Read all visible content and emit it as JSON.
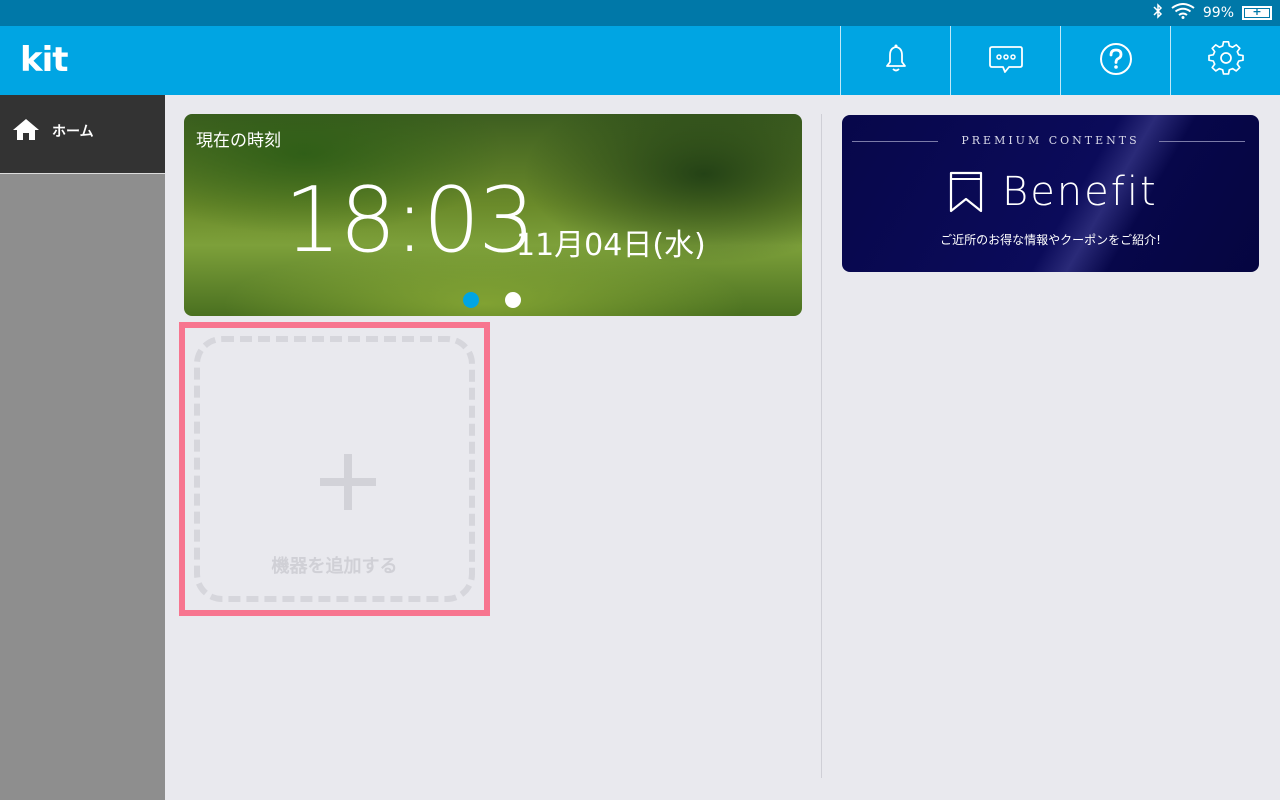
{
  "status_bar": {
    "battery_level": "99%"
  },
  "app": {
    "logo": "kit"
  },
  "header_actions": [
    {
      "name": "notifications",
      "icon": "bell-icon"
    },
    {
      "name": "messages",
      "icon": "chat-bubble-icon"
    },
    {
      "name": "help",
      "icon": "question-icon"
    },
    {
      "name": "settings",
      "icon": "gear-icon"
    }
  ],
  "sidebar": {
    "items": [
      {
        "label": "ホーム",
        "icon": "home-icon",
        "active": true
      }
    ]
  },
  "clock": {
    "label": "現在の時刻",
    "time": "18:03",
    "date": "11月04日(水)",
    "page_count": 2,
    "active_page": 1
  },
  "add_device": {
    "label": "機器を追加する"
  },
  "benefit": {
    "premium_label": "PREMIUM CONTENTS",
    "title": "Benefit",
    "subtitle": "ご近所のお得な情報やクーポンをご紹介!"
  },
  "colors": {
    "accent": "#00a5e3",
    "highlight_border": "#f7758f",
    "benefit_bg": "#07074a"
  }
}
